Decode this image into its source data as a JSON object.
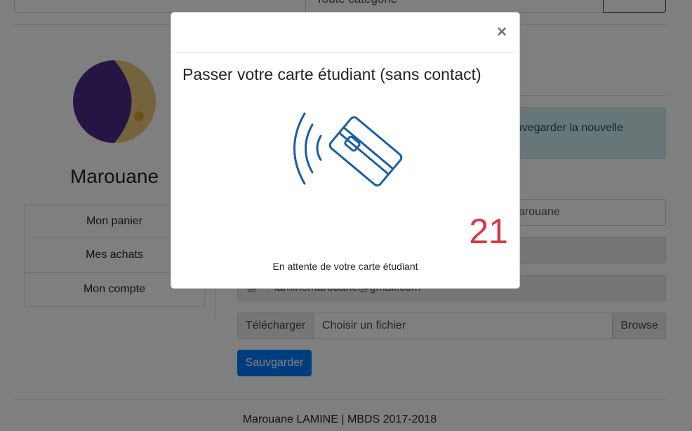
{
  "header": {
    "category_value": "Toute catégorie"
  },
  "profile": {
    "name": "Marouane"
  },
  "sidebar": {
    "items": [
      {
        "label": "Mon panier"
      },
      {
        "label": "Mes achats"
      },
      {
        "label": "Mon compte"
      }
    ]
  },
  "form": {
    "alert_text": "sauvegarder la nouvelle",
    "firstname_value": "arouane",
    "email_addon": "@",
    "email_value": "laminemarouane@gmail.com",
    "file_label": "Télécharger",
    "file_placeholder": "Choisir un fichier",
    "file_browse": "Browse",
    "save_label": "Sauvgarder"
  },
  "footer": {
    "text": "Marouane LAMINE | MBDS 2017-2018"
  },
  "modal": {
    "close_glyph": "×",
    "title": "Passer votre carte étudiant (sans contact)",
    "countdown": "21",
    "status": "En attente de votre carte étudiant",
    "icon": "contactless-card-icon"
  },
  "colors": {
    "primary": "#007bff",
    "countdown": "#dc3545",
    "nfc_icon": "#1a5fa3",
    "alert_bg": "#d1ecf1",
    "avatar_purple": "#4b2a8a",
    "avatar_gold": "#e9c77b"
  }
}
